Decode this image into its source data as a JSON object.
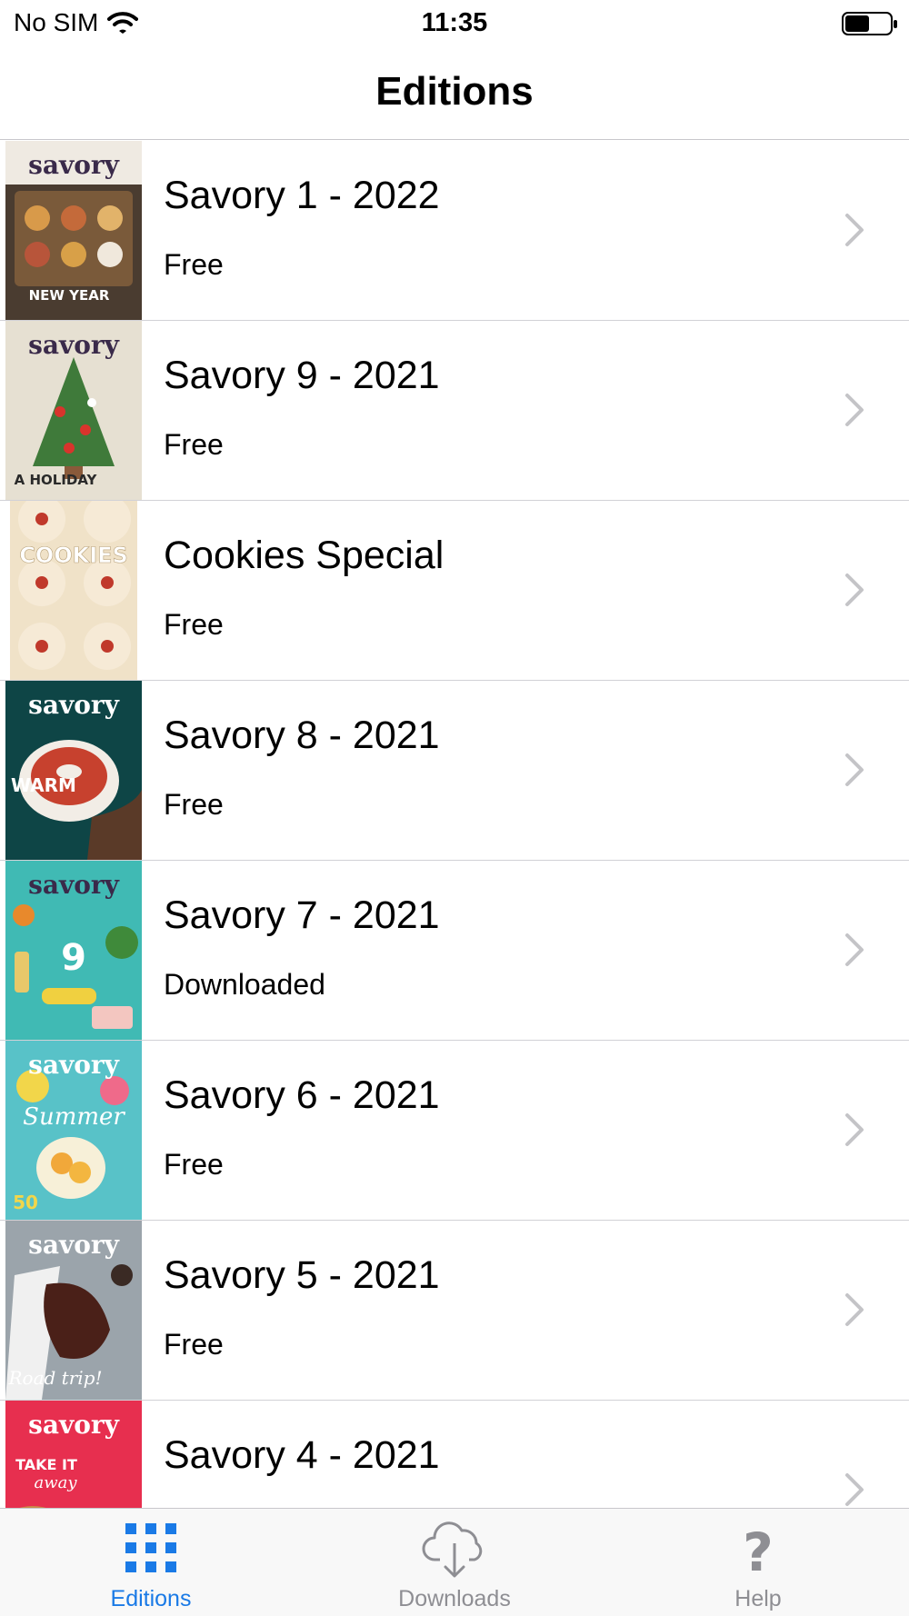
{
  "status_bar": {
    "carrier": "No SIM",
    "time": "11:35"
  },
  "nav": {
    "title": "Editions"
  },
  "editions": [
    {
      "title": "Savory 1 - 2022",
      "status": "Free",
      "cover_color": "#5a4a3a"
    },
    {
      "title": "Savory 9 - 2021",
      "status": "Free",
      "cover_color": "#e8e2d4"
    },
    {
      "title": "Cookies Special",
      "status": "Free",
      "cover_color": "#f1e4cc"
    },
    {
      "title": "Savory 8 - 2021",
      "status": "Free",
      "cover_color": "#0f4848"
    },
    {
      "title": "Savory 7 - 2021",
      "status": "Downloaded",
      "cover_color": "#3fb9b5"
    },
    {
      "title": "Savory 6 - 2021",
      "status": "Free",
      "cover_color": "#57c3c9"
    },
    {
      "title": "Savory 5 - 2021",
      "status": "Free",
      "cover_color": "#9aa3aa"
    },
    {
      "title": "Savory 4 - 2021",
      "status": "",
      "cover_color": "#e8304f"
    }
  ],
  "tabbar": {
    "editions_label": "Editions",
    "downloads_label": "Downloads",
    "help_label": "Help"
  },
  "colors": {
    "accent": "#1a7ae6",
    "inactive": "#8e8e93"
  }
}
